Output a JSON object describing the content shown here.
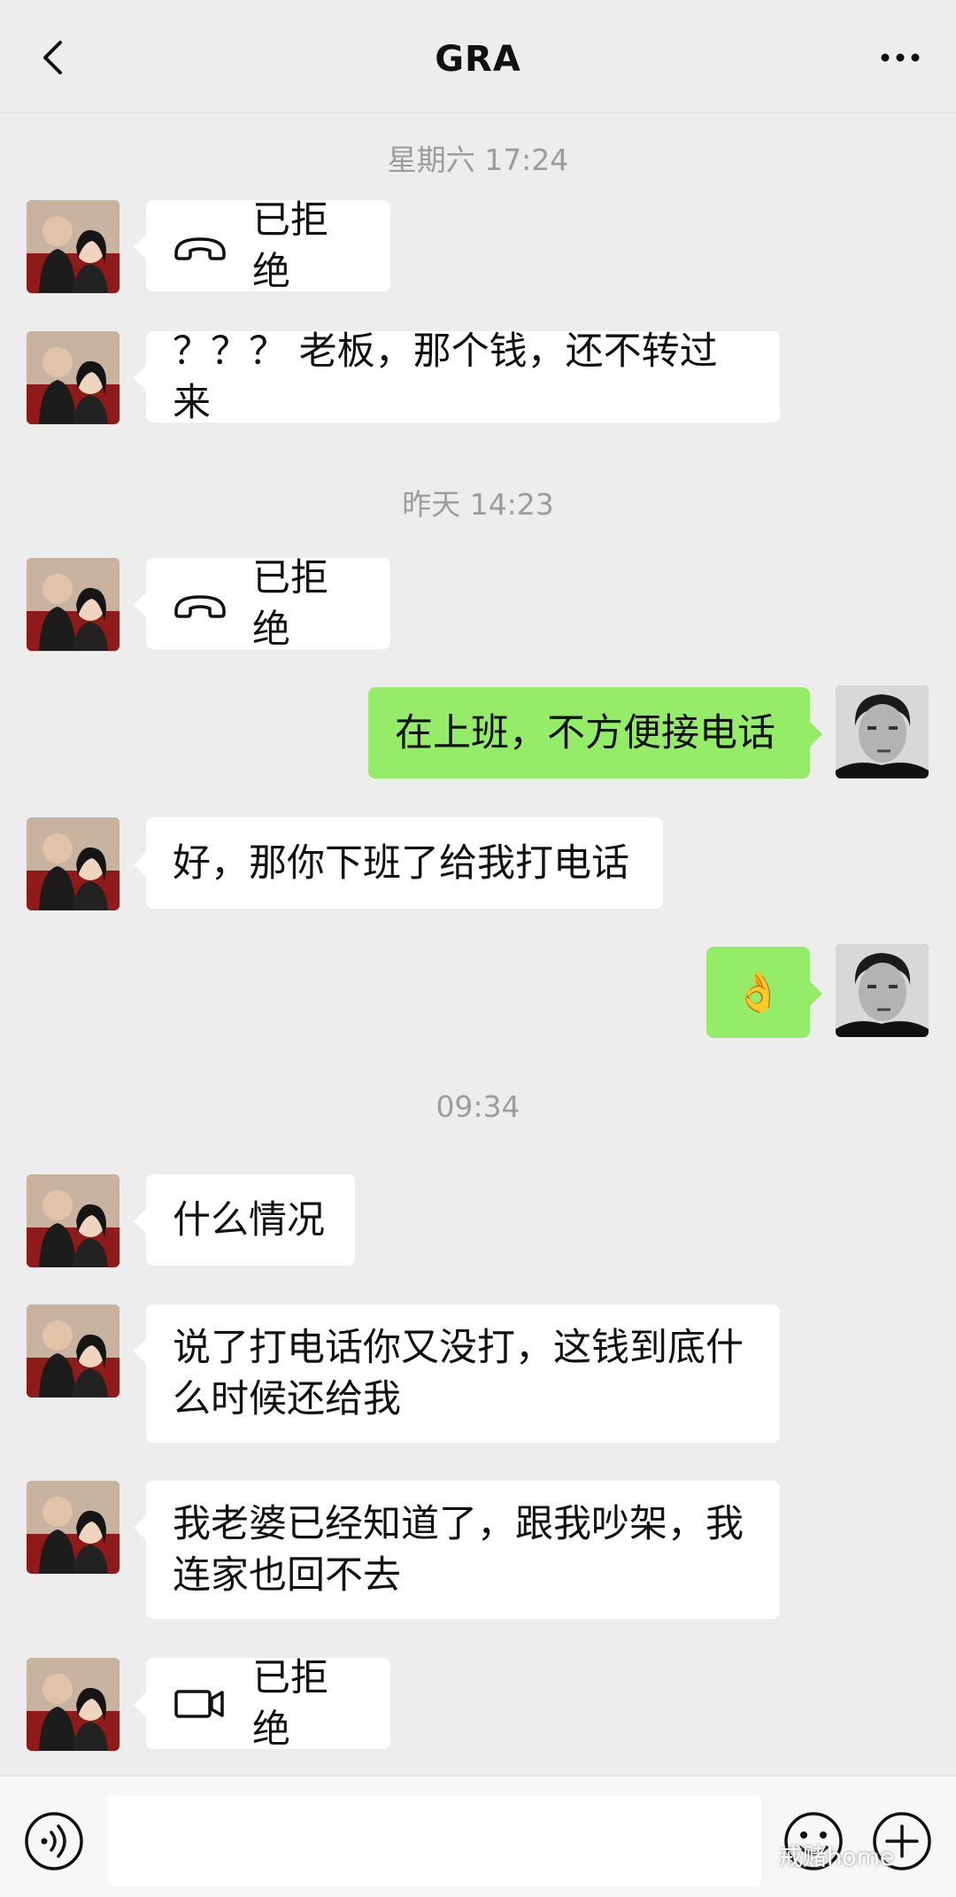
{
  "header": {
    "title": "GRA"
  },
  "timestamps": [
    "星期六 17:24",
    "昨天 14:23",
    "09:34"
  ],
  "messages": {
    "m1": "已拒绝",
    "m2": "？？？ 老板，那个钱，还不转过来",
    "m3": "已拒绝",
    "m4": "在上班，不方便接电话",
    "m5": "好，那你下班了给我打电话",
    "m6": "👌",
    "m7": "什么情况",
    "m8_line1": "说了打电话你又没打，这钱到底什",
    "m8_line2": "么时候还给我",
    "m9_line1": "我老婆已经知道了，跟我吵架，我",
    "m9_line2": "连家也回不去",
    "m10": "已拒绝"
  },
  "icons": {
    "back": "chevron-left-icon",
    "more": "more-dots-icon",
    "voice_call": "phone-hangup-icon",
    "video_call": "video-camera-icon",
    "voice_input": "voice-icon",
    "emoji": "emoji-icon",
    "plus": "plus-icon"
  },
  "colors": {
    "background": "#ededed",
    "bubble_self": "#95ec69",
    "bubble_other": "#ffffff",
    "timestamp": "#9c9c9c"
  },
  "watermark": "戒赌home"
}
